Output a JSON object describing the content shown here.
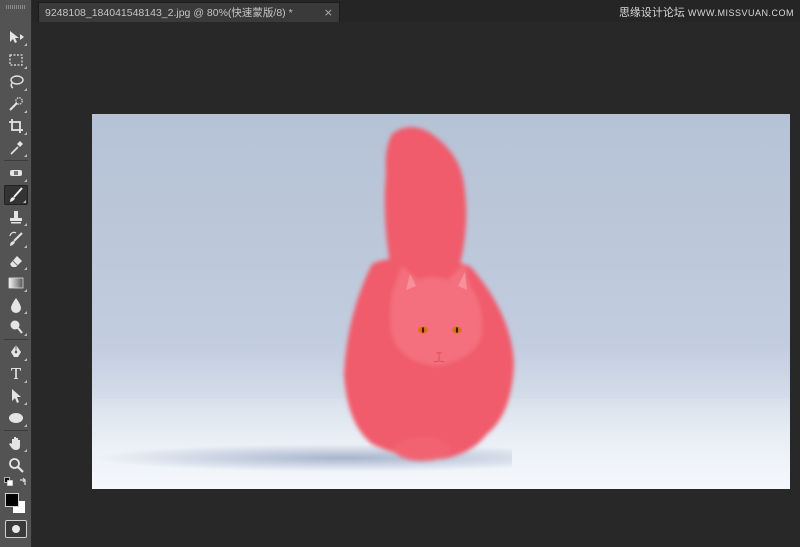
{
  "document": {
    "title": "9248108_184041548143_2.jpg @ 80%(快速蒙版/8) *",
    "close": "×"
  },
  "watermark": {
    "chinese": "思缘设计论坛",
    "brand": "WWW.MISSVUAN.COM"
  },
  "toolbar": {
    "tools": [
      {
        "name": "move-tool",
        "icon": "move-icon"
      },
      {
        "name": "marquee-tool",
        "icon": "marquee-icon"
      },
      {
        "name": "lasso-tool",
        "icon": "lasso-icon"
      },
      {
        "name": "quick-selection-tool",
        "icon": "quick-selection-icon"
      },
      {
        "name": "crop-tool",
        "icon": "crop-icon"
      },
      {
        "name": "eyedropper-tool",
        "icon": "eyedropper-icon"
      },
      {
        "name": "spot-healing-tool",
        "icon": "healing-icon"
      },
      {
        "name": "brush-tool",
        "icon": "brush-icon",
        "active": true
      },
      {
        "name": "clone-stamp-tool",
        "icon": "stamp-icon"
      },
      {
        "name": "history-brush-tool",
        "icon": "history-brush-icon"
      },
      {
        "name": "eraser-tool",
        "icon": "eraser-icon"
      },
      {
        "name": "gradient-tool",
        "icon": "gradient-icon"
      },
      {
        "name": "blur-tool",
        "icon": "blur-drop-icon"
      },
      {
        "name": "dodge-tool",
        "icon": "dodge-icon"
      },
      {
        "name": "pen-tool",
        "icon": "pen-icon"
      },
      {
        "name": "type-tool",
        "icon": "type-icon",
        "glyph": "T"
      },
      {
        "name": "path-selection-tool",
        "icon": "path-selection-icon"
      },
      {
        "name": "ellipse-tool",
        "icon": "ellipse-icon"
      },
      {
        "name": "hand-tool",
        "icon": "hand-icon"
      },
      {
        "name": "zoom-tool",
        "icon": "zoom-icon"
      }
    ],
    "colors": {
      "foreground": "#000000",
      "background": "#ffffff"
    }
  },
  "colors": {
    "quick_mask_overlay": "#f05a6a",
    "eye": "#e0701a"
  }
}
